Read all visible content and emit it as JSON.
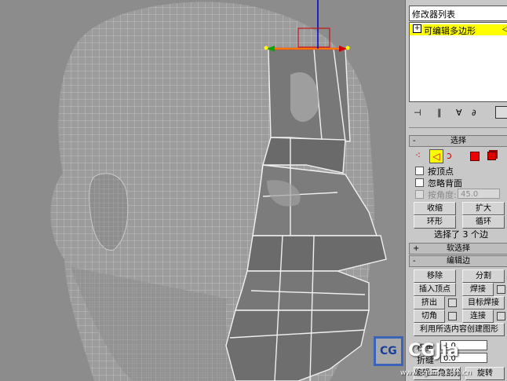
{
  "modifier_list_label": "修改器列表",
  "stack": {
    "toggle": "+",
    "item_label": "可编辑多边形"
  },
  "selection": {
    "title": "选择",
    "collapse_sign": "-",
    "by_vertex": "按顶点",
    "ignore_backfacing": "忽略背面",
    "by_angle": "按角度:",
    "angle_value": "45.0",
    "shrink": "收缩",
    "grow": "扩大",
    "ring": "环形",
    "loop": "循环",
    "status": "选择了 3 个边"
  },
  "soft_selection": {
    "sign": "+",
    "title": "软选择"
  },
  "edit_edges": {
    "sign": "-",
    "title": "编辑边",
    "remove": "移除",
    "split": "分割",
    "insert_vertex": "插入顶点",
    "weld": "焊接",
    "extrude": "挤出",
    "target_weld": "目标焊接",
    "chamfer": "切角",
    "connect": "连接",
    "create_shape": "利用所选内容创建图形",
    "weight_label": "权重",
    "weight_value": "1.0",
    "crease_label": "折缝",
    "crease_value": "0.0",
    "edit_tri": "编辑三角剖分",
    "rotate": "旋转"
  },
  "watermark": {
    "logo": "CG",
    "brand": "CGJia",
    "url": "www.cgtime.com.cn"
  },
  "colors": {
    "highlight": "#ffff00",
    "edge_sel": "#ff2200",
    "viewport": "#8c8c8c",
    "panel": "#c8c8c8"
  }
}
